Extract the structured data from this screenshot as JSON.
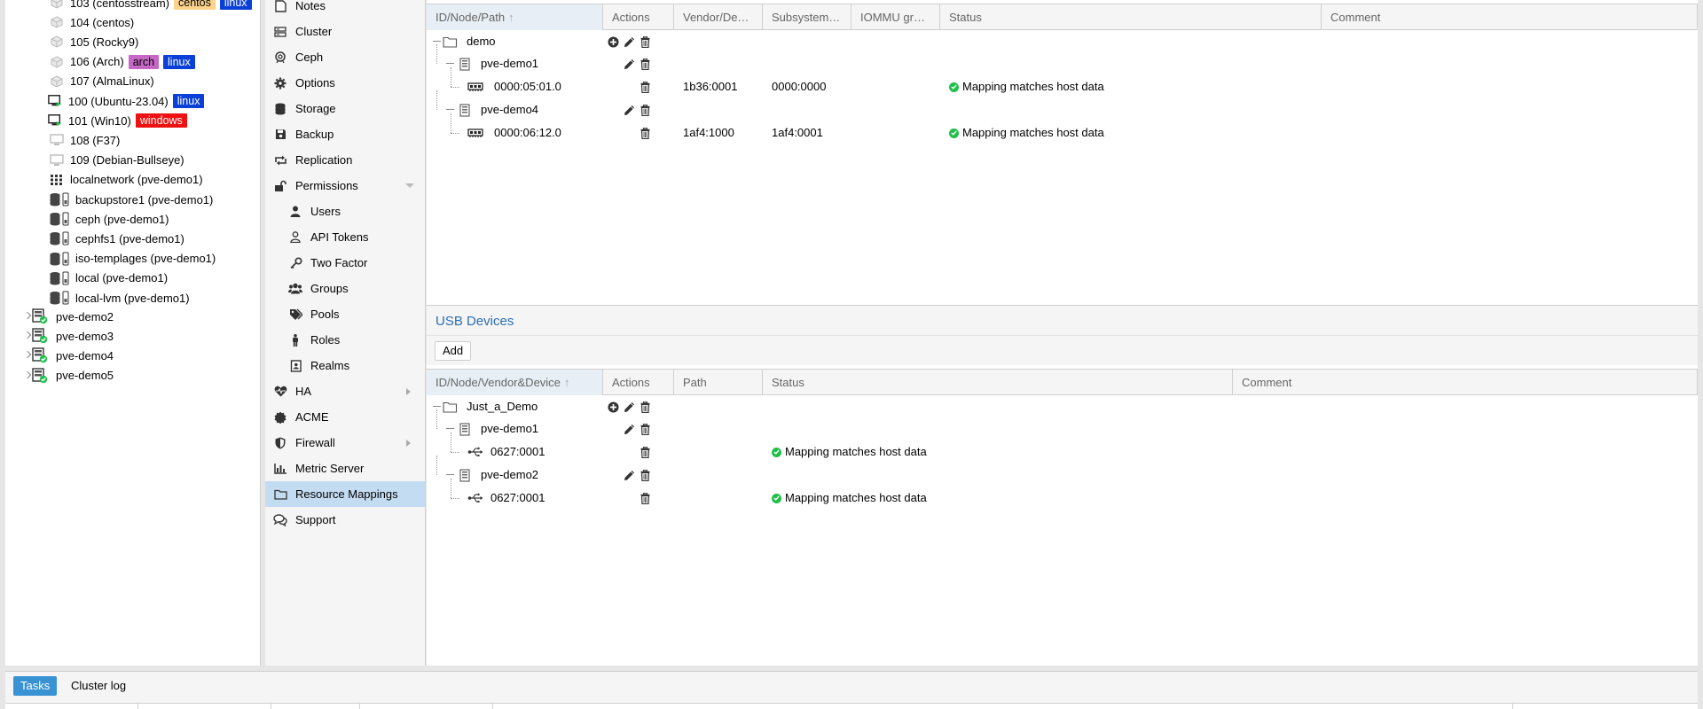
{
  "colors": {
    "tag_centos": "#fcd38b",
    "tag_linux": "#0b40d8",
    "tag_arch": "#c667c6",
    "tag_windows": "#ee1111",
    "accent": "#2a6eb3",
    "running": "#21bf4b"
  },
  "tree": {
    "items": [
      {
        "label": "103 (centosstream)",
        "icon": "vm-template-icon",
        "tags": [
          {
            "text": "centos",
            "color": "#fcd38b",
            "fg": "#000"
          },
          {
            "text": "linux",
            "color": "#0b40d8",
            "fg": "#fff"
          }
        ]
      },
      {
        "label": "104 (centos)",
        "icon": "vm-template-icon",
        "tags": []
      },
      {
        "label": "105 (Rocky9)",
        "icon": "vm-template-icon",
        "tags": []
      },
      {
        "label": "106 (Arch)",
        "icon": "vm-template-icon",
        "tags": [
          {
            "text": "arch",
            "color": "#c667c6",
            "fg": "#000"
          },
          {
            "text": "linux",
            "color": "#0b40d8",
            "fg": "#fff"
          }
        ]
      },
      {
        "label": "107 (AlmaLinux)",
        "icon": "vm-template-icon",
        "tags": []
      },
      {
        "label": "100 (Ubuntu-23.04)",
        "icon": "vm-running-icon",
        "tags": [
          {
            "text": "linux",
            "color": "#0b40d8",
            "fg": "#fff"
          }
        ]
      },
      {
        "label": "101 (Win10)",
        "icon": "vm-running-icon",
        "tags": [
          {
            "text": "windows",
            "color": "#ee1111",
            "fg": "#fff"
          }
        ]
      },
      {
        "label": "108 (F37)",
        "icon": "vm-stopped-icon",
        "tags": []
      },
      {
        "label": "109 (Debian-Bullseye)",
        "icon": "vm-stopped-icon",
        "tags": []
      },
      {
        "label": "localnetwork (pve-demo1)",
        "icon": "sdn-grid-icon",
        "tags": []
      },
      {
        "label": "backupstore1 (pve-demo1)",
        "icon": "storage-icon",
        "tags": []
      },
      {
        "label": "ceph (pve-demo1)",
        "icon": "storage-icon",
        "tags": []
      },
      {
        "label": "cephfs1 (pve-demo1)",
        "icon": "storage-icon",
        "tags": []
      },
      {
        "label": "iso-templages (pve-demo1)",
        "icon": "storage-icon",
        "tags": []
      },
      {
        "label": "local (pve-demo1)",
        "icon": "storage-icon",
        "tags": []
      },
      {
        "label": "local-lvm (pve-demo1)",
        "icon": "storage-icon",
        "tags": []
      }
    ],
    "nodes": [
      {
        "label": "pve-demo2"
      },
      {
        "label": "pve-demo3"
      },
      {
        "label": "pve-demo4"
      },
      {
        "label": "pve-demo5"
      }
    ]
  },
  "menu": {
    "items": [
      {
        "label": "Notes",
        "icon": "notes-icon",
        "sub": false
      },
      {
        "label": "Cluster",
        "icon": "server-icon",
        "sub": false
      },
      {
        "label": "Ceph",
        "icon": "ceph-icon",
        "sub": false
      },
      {
        "label": "Options",
        "icon": "gear-icon",
        "sub": false
      },
      {
        "label": "Storage",
        "icon": "database-icon",
        "sub": false
      },
      {
        "label": "Backup",
        "icon": "floppy-icon",
        "sub": false
      },
      {
        "label": "Replication",
        "icon": "retweet-icon",
        "sub": false
      },
      {
        "label": "Permissions",
        "icon": "unlock-icon",
        "sub": false,
        "expanded": true
      },
      {
        "label": "Users",
        "icon": "user-icon",
        "sub": true
      },
      {
        "label": "API Tokens",
        "icon": "user-outline-icon",
        "sub": true
      },
      {
        "label": "Two Factor",
        "icon": "key-icon",
        "sub": true
      },
      {
        "label": "Groups",
        "icon": "users-icon",
        "sub": true
      },
      {
        "label": "Pools",
        "icon": "tags-icon",
        "sub": true
      },
      {
        "label": "Roles",
        "icon": "male-icon",
        "sub": true
      },
      {
        "label": "Realms",
        "icon": "address-book-icon",
        "sub": true
      },
      {
        "label": "HA",
        "icon": "heartbeat-icon",
        "sub": false,
        "collapsed": true
      },
      {
        "label": "ACME",
        "icon": "certificate-icon",
        "sub": false
      },
      {
        "label": "Firewall",
        "icon": "shield-icon",
        "sub": false,
        "collapsed": true
      },
      {
        "label": "Metric Server",
        "icon": "bar-chart-icon",
        "sub": false
      },
      {
        "label": "Resource Mappings",
        "icon": "folder-icon",
        "sub": false,
        "active": true
      },
      {
        "label": "Support",
        "icon": "comments-icon",
        "sub": false
      }
    ]
  },
  "pci": {
    "columns": [
      {
        "label": "ID/Node/Path",
        "sorted": true
      },
      {
        "label": "Actions"
      },
      {
        "label": "Vendor/De…"
      },
      {
        "label": "Subsystem…"
      },
      {
        "label": "IOMMU gr…"
      },
      {
        "label": "Status"
      },
      {
        "label": "Comment"
      }
    ],
    "rows": [
      {
        "level": 0,
        "kind": "folder",
        "label": "demo",
        "actions": [
          "add",
          "edit",
          "delete"
        ],
        "vendor": "",
        "subsystem": "",
        "status": ""
      },
      {
        "level": 1,
        "kind": "node",
        "label": "pve-demo1",
        "actions": [
          "edit",
          "delete"
        ],
        "vendor": "",
        "subsystem": "",
        "status": ""
      },
      {
        "level": 2,
        "kind": "pci",
        "label": "0000:05:01.0",
        "actions": [
          "delete"
        ],
        "vendor": "1b36:0001",
        "subsystem": "0000:0000",
        "status": "Mapping matches host data"
      },
      {
        "level": 1,
        "kind": "node",
        "label": "pve-demo4",
        "actions": [
          "edit",
          "delete"
        ],
        "vendor": "",
        "subsystem": "",
        "status": ""
      },
      {
        "level": 2,
        "kind": "pci",
        "label": "0000:06:12.0",
        "actions": [
          "delete"
        ],
        "vendor": "1af4:1000",
        "subsystem": "1af4:0001",
        "status": "Mapping matches host data"
      }
    ]
  },
  "usb": {
    "title": "USB Devices",
    "add_label": "Add",
    "columns": [
      {
        "label": "ID/Node/Vendor&Device",
        "sorted": true
      },
      {
        "label": "Actions"
      },
      {
        "label": "Path"
      },
      {
        "label": "Status"
      },
      {
        "label": "Comment"
      }
    ],
    "rows": [
      {
        "level": 0,
        "kind": "folder",
        "label": "Just_a_Demo",
        "actions": [
          "add",
          "edit",
          "delete"
        ],
        "path": "",
        "status": ""
      },
      {
        "level": 1,
        "kind": "node",
        "label": "pve-demo1",
        "actions": [
          "edit",
          "delete"
        ],
        "path": "",
        "status": ""
      },
      {
        "level": 2,
        "kind": "usb",
        "label": "0627:0001",
        "actions": [
          "delete"
        ],
        "path": "",
        "status": "Mapping matches host data"
      },
      {
        "level": 1,
        "kind": "node",
        "label": "pve-demo2",
        "actions": [
          "edit",
          "delete"
        ],
        "path": "",
        "status": ""
      },
      {
        "level": 2,
        "kind": "usb",
        "label": "0627:0001",
        "actions": [
          "delete"
        ],
        "path": "",
        "status": "Mapping matches host data"
      }
    ]
  },
  "bottom": {
    "tabs": [
      {
        "label": "Tasks",
        "active": true
      },
      {
        "label": "Cluster log",
        "active": false
      }
    ]
  }
}
